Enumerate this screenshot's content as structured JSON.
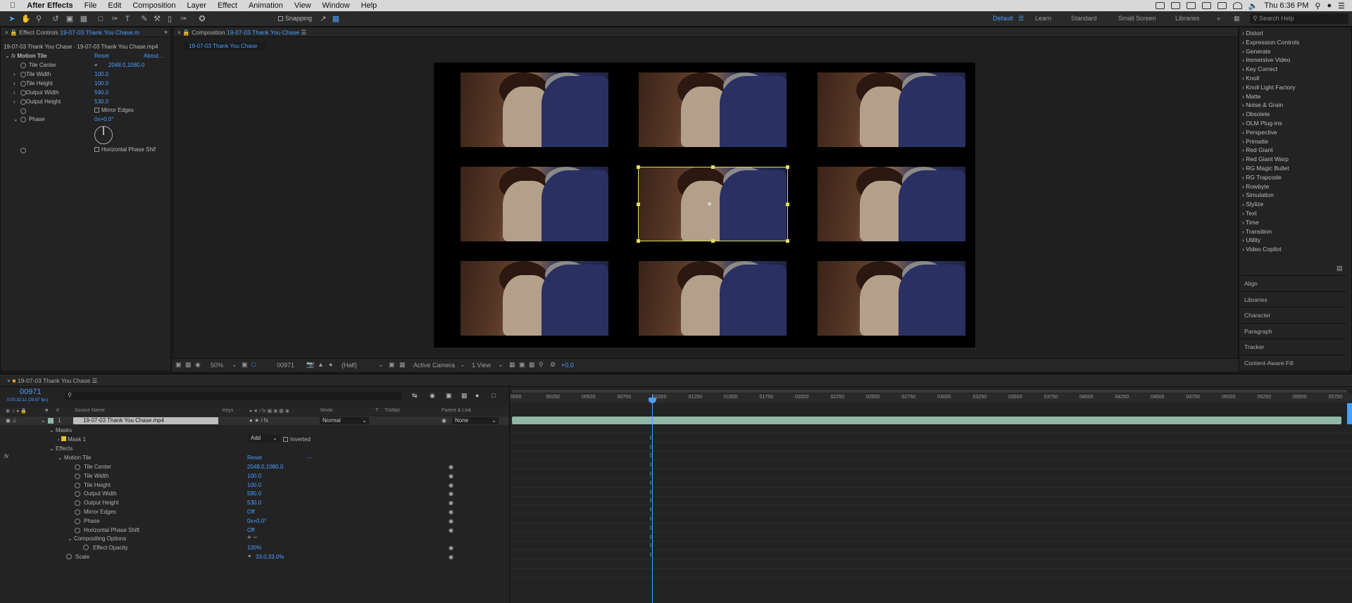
{
  "menubar": {
    "app": "After Effects",
    "items": [
      "File",
      "Edit",
      "Composition",
      "Layer",
      "Effect",
      "Animation",
      "View",
      "Window",
      "Help"
    ],
    "clock": "Thu 6:36 PM"
  },
  "toolbar": {
    "snapping": "Snapping",
    "workspaces": [
      "Default",
      "Learn",
      "Standard",
      "Small Screen",
      "Libraries"
    ],
    "search_placeholder": "Search Help"
  },
  "effect_controls": {
    "tab_prefix": "Effect Controls",
    "tab_name": "19-07-03 Thank You Chase.m",
    "breadcrumb": "19-07-03 Thank You Chase · 19-07-03 Thank You Chase.mp4",
    "effect": "Motion Tile",
    "reset": "Reset",
    "about": "About...",
    "params": [
      {
        "name": "Tile Center",
        "value": "2048.0,1080.0"
      },
      {
        "name": "Tile Width",
        "value": "100.0"
      },
      {
        "name": "Tile Height",
        "value": "100.0"
      },
      {
        "name": "Output Width",
        "value": "590.0"
      },
      {
        "name": "Output Height",
        "value": "530.0"
      }
    ],
    "mirror_edges": "Mirror Edges",
    "phase": "Phase",
    "phase_value": "0x+0.0°",
    "hps": "Horizontal Phase Shif"
  },
  "composition": {
    "tab_prefix": "Composition",
    "tab_name": "19-07-03 Thank You Chase",
    "sub_tab": "19-07-03 Thank You Chase"
  },
  "viewer_bar": {
    "zoom": "50%",
    "timecode": "00971",
    "resolution": "(Half)",
    "camera": "Active Camera",
    "views": "1 View",
    "exposure": "+0.0"
  },
  "effects_panel": {
    "items": [
      "Distort",
      "Expression Controls",
      "Generate",
      "Immersive Video",
      "Key Correct",
      "Knoll",
      "Knoll Light Factory",
      "Matte",
      "Noise & Grain",
      "Obsolete",
      "OLM Plug-ins",
      "Perspective",
      "Primatte",
      "Red Giant",
      "Red Giant Warp",
      "RG Magic Bullet",
      "RG Trapcode",
      "Rowbyte",
      "Simulation",
      "Stylize",
      "Text",
      "Time",
      "Transition",
      "Utility",
      "Video Copilot"
    ],
    "panels": [
      "Align",
      "Libraries",
      "Character",
      "Paragraph",
      "Tracker",
      "Content-Aware Fill"
    ]
  },
  "timeline": {
    "comp_name": "19-07-03 Thank You Chase",
    "timecode": "00971",
    "subtime": "0:00:32:11 (29.97 fps)",
    "headers": {
      "source": "Source Name",
      "keys": "Keys",
      "mode": "Mode",
      "t": "T",
      "trkmat": "TrkMat",
      "parent": "Parent & Link"
    },
    "layer": {
      "index": "1",
      "name": "19-07-03 Thank You Chase.mp4",
      "mode": "Normal",
      "parent": "None"
    },
    "masks": "Masks",
    "mask1": "Mask 1",
    "mask_mode": "Add",
    "inverted": "Inverted",
    "effects": "Effects",
    "motion_tile": "Motion Tile",
    "reset": "Reset",
    "dots": "...",
    "props": [
      {
        "name": "Tile Center",
        "value": "2048.0,1080.0"
      },
      {
        "name": "Tile Width",
        "value": "100.0"
      },
      {
        "name": "Tile Height",
        "value": "100.0"
      },
      {
        "name": "Output Width",
        "value": "590.0"
      },
      {
        "name": "Output Height",
        "value": "530.0"
      },
      {
        "name": "Mirror Edges",
        "value": "Off"
      },
      {
        "name": "Phase",
        "value": "0x+0.0°"
      },
      {
        "name": "Horizontal Phase Shift",
        "value": "Off"
      }
    ],
    "compositing": "Compositing Options",
    "effect_opacity": "Effect Opacity",
    "effect_opacity_value": "100%",
    "scale": "Scale",
    "scale_value": "33.0,33.0%",
    "ruler": [
      "0000",
      "00250",
      "00500",
      "00750",
      "01000",
      "01250",
      "01500",
      "01750",
      "02000",
      "02250",
      "02500",
      "02750",
      "03000",
      "03250",
      "03500",
      "03750",
      "04000",
      "04250",
      "04500",
      "04750",
      "05000",
      "05250",
      "05500",
      "05750"
    ],
    "layer_bar_color": "#8fb8a8"
  }
}
